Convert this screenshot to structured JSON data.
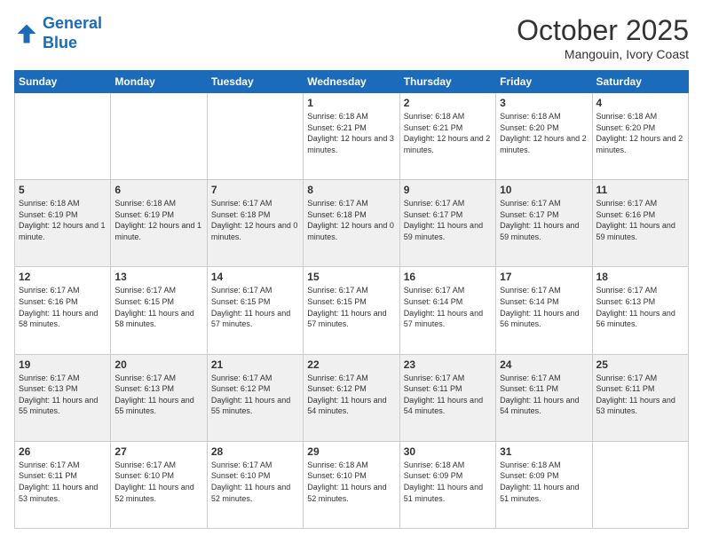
{
  "header": {
    "logo_line1": "General",
    "logo_line2": "Blue",
    "month": "October 2025",
    "location": "Mangouin, Ivory Coast"
  },
  "days_of_week": [
    "Sunday",
    "Monday",
    "Tuesday",
    "Wednesday",
    "Thursday",
    "Friday",
    "Saturday"
  ],
  "weeks": [
    [
      {
        "day": "",
        "info": ""
      },
      {
        "day": "",
        "info": ""
      },
      {
        "day": "",
        "info": ""
      },
      {
        "day": "1",
        "info": "Sunrise: 6:18 AM\nSunset: 6:21 PM\nDaylight: 12 hours and 3 minutes."
      },
      {
        "day": "2",
        "info": "Sunrise: 6:18 AM\nSunset: 6:21 PM\nDaylight: 12 hours and 2 minutes."
      },
      {
        "day": "3",
        "info": "Sunrise: 6:18 AM\nSunset: 6:20 PM\nDaylight: 12 hours and 2 minutes."
      },
      {
        "day": "4",
        "info": "Sunrise: 6:18 AM\nSunset: 6:20 PM\nDaylight: 12 hours and 2 minutes."
      }
    ],
    [
      {
        "day": "5",
        "info": "Sunrise: 6:18 AM\nSunset: 6:19 PM\nDaylight: 12 hours and 1 minute."
      },
      {
        "day": "6",
        "info": "Sunrise: 6:18 AM\nSunset: 6:19 PM\nDaylight: 12 hours and 1 minute."
      },
      {
        "day": "7",
        "info": "Sunrise: 6:17 AM\nSunset: 6:18 PM\nDaylight: 12 hours and 0 minutes."
      },
      {
        "day": "8",
        "info": "Sunrise: 6:17 AM\nSunset: 6:18 PM\nDaylight: 12 hours and 0 minutes."
      },
      {
        "day": "9",
        "info": "Sunrise: 6:17 AM\nSunset: 6:17 PM\nDaylight: 11 hours and 59 minutes."
      },
      {
        "day": "10",
        "info": "Sunrise: 6:17 AM\nSunset: 6:17 PM\nDaylight: 11 hours and 59 minutes."
      },
      {
        "day": "11",
        "info": "Sunrise: 6:17 AM\nSunset: 6:16 PM\nDaylight: 11 hours and 59 minutes."
      }
    ],
    [
      {
        "day": "12",
        "info": "Sunrise: 6:17 AM\nSunset: 6:16 PM\nDaylight: 11 hours and 58 minutes."
      },
      {
        "day": "13",
        "info": "Sunrise: 6:17 AM\nSunset: 6:15 PM\nDaylight: 11 hours and 58 minutes."
      },
      {
        "day": "14",
        "info": "Sunrise: 6:17 AM\nSunset: 6:15 PM\nDaylight: 11 hours and 57 minutes."
      },
      {
        "day": "15",
        "info": "Sunrise: 6:17 AM\nSunset: 6:15 PM\nDaylight: 11 hours and 57 minutes."
      },
      {
        "day": "16",
        "info": "Sunrise: 6:17 AM\nSunset: 6:14 PM\nDaylight: 11 hours and 57 minutes."
      },
      {
        "day": "17",
        "info": "Sunrise: 6:17 AM\nSunset: 6:14 PM\nDaylight: 11 hours and 56 minutes."
      },
      {
        "day": "18",
        "info": "Sunrise: 6:17 AM\nSunset: 6:13 PM\nDaylight: 11 hours and 56 minutes."
      }
    ],
    [
      {
        "day": "19",
        "info": "Sunrise: 6:17 AM\nSunset: 6:13 PM\nDaylight: 11 hours and 55 minutes."
      },
      {
        "day": "20",
        "info": "Sunrise: 6:17 AM\nSunset: 6:13 PM\nDaylight: 11 hours and 55 minutes."
      },
      {
        "day": "21",
        "info": "Sunrise: 6:17 AM\nSunset: 6:12 PM\nDaylight: 11 hours and 55 minutes."
      },
      {
        "day": "22",
        "info": "Sunrise: 6:17 AM\nSunset: 6:12 PM\nDaylight: 11 hours and 54 minutes."
      },
      {
        "day": "23",
        "info": "Sunrise: 6:17 AM\nSunset: 6:11 PM\nDaylight: 11 hours and 54 minutes."
      },
      {
        "day": "24",
        "info": "Sunrise: 6:17 AM\nSunset: 6:11 PM\nDaylight: 11 hours and 54 minutes."
      },
      {
        "day": "25",
        "info": "Sunrise: 6:17 AM\nSunset: 6:11 PM\nDaylight: 11 hours and 53 minutes."
      }
    ],
    [
      {
        "day": "26",
        "info": "Sunrise: 6:17 AM\nSunset: 6:11 PM\nDaylight: 11 hours and 53 minutes."
      },
      {
        "day": "27",
        "info": "Sunrise: 6:17 AM\nSunset: 6:10 PM\nDaylight: 11 hours and 52 minutes."
      },
      {
        "day": "28",
        "info": "Sunrise: 6:17 AM\nSunset: 6:10 PM\nDaylight: 11 hours and 52 minutes."
      },
      {
        "day": "29",
        "info": "Sunrise: 6:18 AM\nSunset: 6:10 PM\nDaylight: 11 hours and 52 minutes."
      },
      {
        "day": "30",
        "info": "Sunrise: 6:18 AM\nSunset: 6:09 PM\nDaylight: 11 hours and 51 minutes."
      },
      {
        "day": "31",
        "info": "Sunrise: 6:18 AM\nSunset: 6:09 PM\nDaylight: 11 hours and 51 minutes."
      },
      {
        "day": "",
        "info": ""
      }
    ]
  ]
}
